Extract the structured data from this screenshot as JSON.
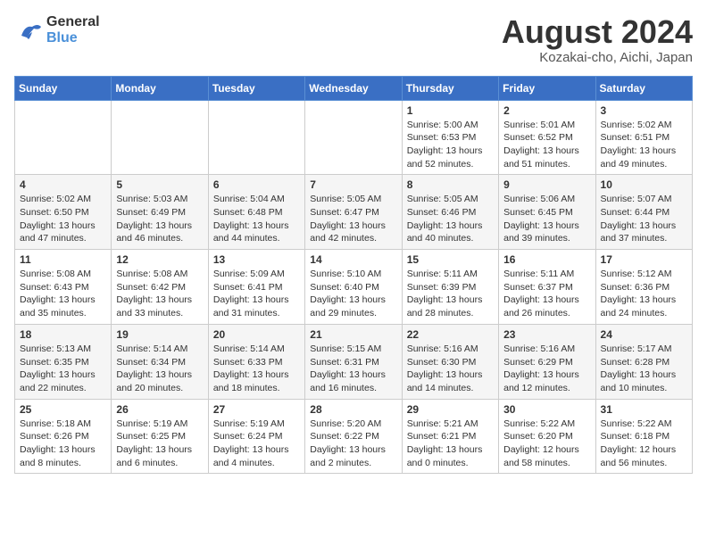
{
  "header": {
    "logo_line1": "General",
    "logo_line2": "Blue",
    "month_year": "August 2024",
    "location": "Kozakai-cho, Aichi, Japan"
  },
  "weekdays": [
    "Sunday",
    "Monday",
    "Tuesday",
    "Wednesday",
    "Thursday",
    "Friday",
    "Saturday"
  ],
  "weeks": [
    [
      {
        "day": "",
        "info": ""
      },
      {
        "day": "",
        "info": ""
      },
      {
        "day": "",
        "info": ""
      },
      {
        "day": "",
        "info": ""
      },
      {
        "day": "1",
        "info": "Sunrise: 5:00 AM\nSunset: 6:53 PM\nDaylight: 13 hours\nand 52 minutes."
      },
      {
        "day": "2",
        "info": "Sunrise: 5:01 AM\nSunset: 6:52 PM\nDaylight: 13 hours\nand 51 minutes."
      },
      {
        "day": "3",
        "info": "Sunrise: 5:02 AM\nSunset: 6:51 PM\nDaylight: 13 hours\nand 49 minutes."
      }
    ],
    [
      {
        "day": "4",
        "info": "Sunrise: 5:02 AM\nSunset: 6:50 PM\nDaylight: 13 hours\nand 47 minutes."
      },
      {
        "day": "5",
        "info": "Sunrise: 5:03 AM\nSunset: 6:49 PM\nDaylight: 13 hours\nand 46 minutes."
      },
      {
        "day": "6",
        "info": "Sunrise: 5:04 AM\nSunset: 6:48 PM\nDaylight: 13 hours\nand 44 minutes."
      },
      {
        "day": "7",
        "info": "Sunrise: 5:05 AM\nSunset: 6:47 PM\nDaylight: 13 hours\nand 42 minutes."
      },
      {
        "day": "8",
        "info": "Sunrise: 5:05 AM\nSunset: 6:46 PM\nDaylight: 13 hours\nand 40 minutes."
      },
      {
        "day": "9",
        "info": "Sunrise: 5:06 AM\nSunset: 6:45 PM\nDaylight: 13 hours\nand 39 minutes."
      },
      {
        "day": "10",
        "info": "Sunrise: 5:07 AM\nSunset: 6:44 PM\nDaylight: 13 hours\nand 37 minutes."
      }
    ],
    [
      {
        "day": "11",
        "info": "Sunrise: 5:08 AM\nSunset: 6:43 PM\nDaylight: 13 hours\nand 35 minutes."
      },
      {
        "day": "12",
        "info": "Sunrise: 5:08 AM\nSunset: 6:42 PM\nDaylight: 13 hours\nand 33 minutes."
      },
      {
        "day": "13",
        "info": "Sunrise: 5:09 AM\nSunset: 6:41 PM\nDaylight: 13 hours\nand 31 minutes."
      },
      {
        "day": "14",
        "info": "Sunrise: 5:10 AM\nSunset: 6:40 PM\nDaylight: 13 hours\nand 29 minutes."
      },
      {
        "day": "15",
        "info": "Sunrise: 5:11 AM\nSunset: 6:39 PM\nDaylight: 13 hours\nand 28 minutes."
      },
      {
        "day": "16",
        "info": "Sunrise: 5:11 AM\nSunset: 6:37 PM\nDaylight: 13 hours\nand 26 minutes."
      },
      {
        "day": "17",
        "info": "Sunrise: 5:12 AM\nSunset: 6:36 PM\nDaylight: 13 hours\nand 24 minutes."
      }
    ],
    [
      {
        "day": "18",
        "info": "Sunrise: 5:13 AM\nSunset: 6:35 PM\nDaylight: 13 hours\nand 22 minutes."
      },
      {
        "day": "19",
        "info": "Sunrise: 5:14 AM\nSunset: 6:34 PM\nDaylight: 13 hours\nand 20 minutes."
      },
      {
        "day": "20",
        "info": "Sunrise: 5:14 AM\nSunset: 6:33 PM\nDaylight: 13 hours\nand 18 minutes."
      },
      {
        "day": "21",
        "info": "Sunrise: 5:15 AM\nSunset: 6:31 PM\nDaylight: 13 hours\nand 16 minutes."
      },
      {
        "day": "22",
        "info": "Sunrise: 5:16 AM\nSunset: 6:30 PM\nDaylight: 13 hours\nand 14 minutes."
      },
      {
        "day": "23",
        "info": "Sunrise: 5:16 AM\nSunset: 6:29 PM\nDaylight: 13 hours\nand 12 minutes."
      },
      {
        "day": "24",
        "info": "Sunrise: 5:17 AM\nSunset: 6:28 PM\nDaylight: 13 hours\nand 10 minutes."
      }
    ],
    [
      {
        "day": "25",
        "info": "Sunrise: 5:18 AM\nSunset: 6:26 PM\nDaylight: 13 hours\nand 8 minutes."
      },
      {
        "day": "26",
        "info": "Sunrise: 5:19 AM\nSunset: 6:25 PM\nDaylight: 13 hours\nand 6 minutes."
      },
      {
        "day": "27",
        "info": "Sunrise: 5:19 AM\nSunset: 6:24 PM\nDaylight: 13 hours\nand 4 minutes."
      },
      {
        "day": "28",
        "info": "Sunrise: 5:20 AM\nSunset: 6:22 PM\nDaylight: 13 hours\nand 2 minutes."
      },
      {
        "day": "29",
        "info": "Sunrise: 5:21 AM\nSunset: 6:21 PM\nDaylight: 13 hours\nand 0 minutes."
      },
      {
        "day": "30",
        "info": "Sunrise: 5:22 AM\nSunset: 6:20 PM\nDaylight: 12 hours\nand 58 minutes."
      },
      {
        "day": "31",
        "info": "Sunrise: 5:22 AM\nSunset: 6:18 PM\nDaylight: 12 hours\nand 56 minutes."
      }
    ]
  ]
}
